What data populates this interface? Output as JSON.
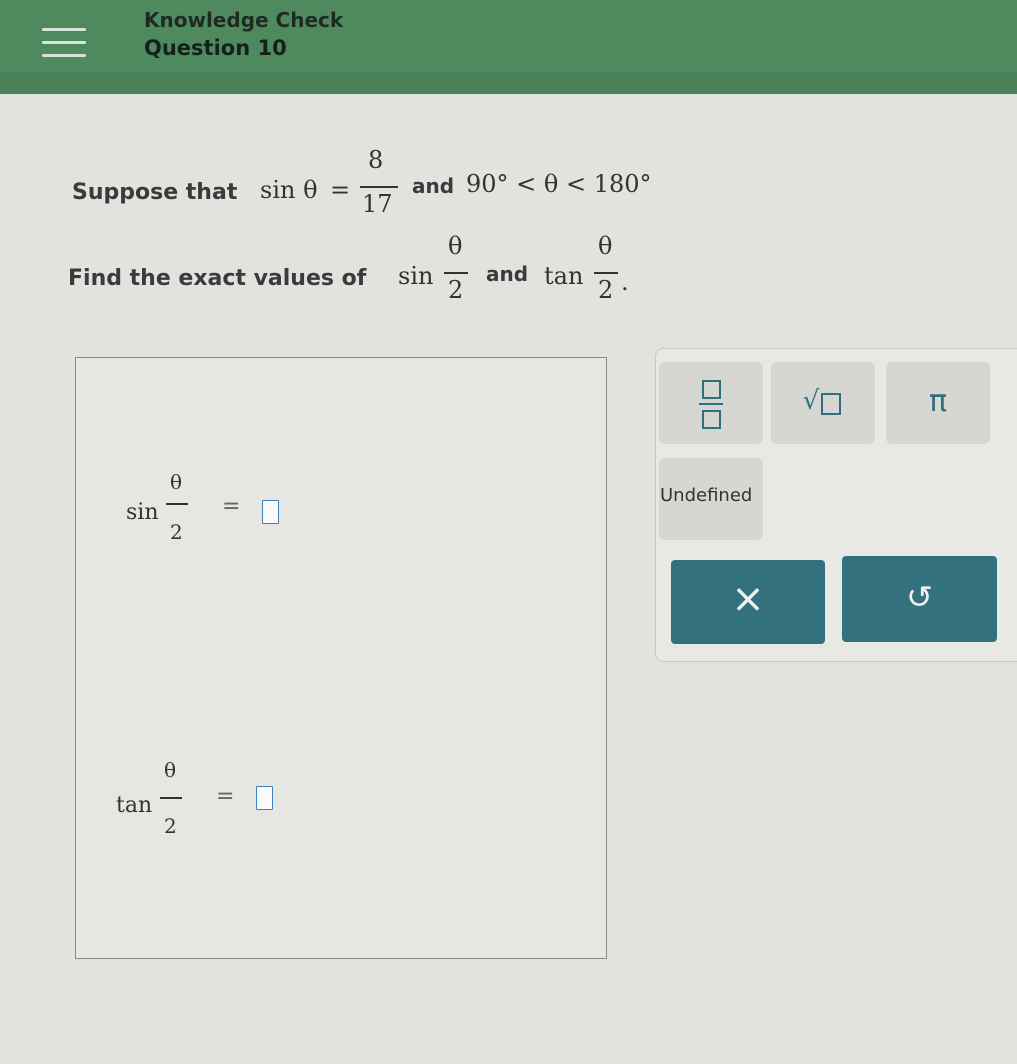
{
  "header": {
    "title": "Knowledge Check",
    "subtitle": "Question 10"
  },
  "question": {
    "line1_prefix": "Suppose that",
    "sin_theta": "sin θ",
    "equals": "=",
    "numerator": "8",
    "denominator": "17",
    "and": "and",
    "range": "90° < θ < 180°",
    "period": ".",
    "line2_prefix": "Find the exact values of",
    "sin": "sin",
    "tan": "tan",
    "half_num": "θ",
    "half_den": "2",
    "and2": "and",
    "period2": "."
  },
  "answers": {
    "sin_label": "sin",
    "tan_label": "tan",
    "theta": "θ",
    "two": "2",
    "equals": "="
  },
  "keypad": {
    "fraction_key": "fraction",
    "sqrt_key": "√",
    "pi_key": "π",
    "undefined_key": "Undefined",
    "clear_key": "×",
    "undo_key": "↺"
  }
}
